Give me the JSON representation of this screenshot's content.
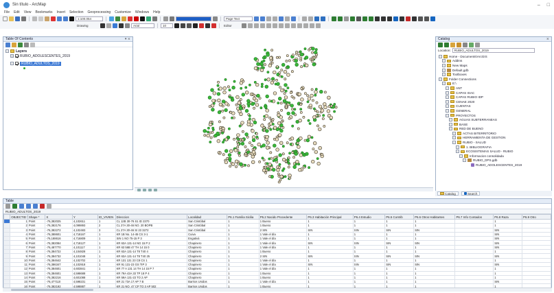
{
  "window": {
    "title": "Sin título - ArcMap",
    "controls": [
      "–",
      "□"
    ]
  },
  "menu": [
    "File",
    "Edit",
    "View",
    "Bookmarks",
    "Insert",
    "Selection",
    "Geoprocessing",
    "Customize",
    "Windows",
    "Help"
  ],
  "toolbar1": {
    "scale": "1:100.054",
    "page_label": "Page Text"
  },
  "toolbar2": {
    "drawing_label": "Drawing",
    "font": "Arial",
    "size": "10",
    "editor_label": "Editor"
  },
  "toc": {
    "title": "Table Of Contents",
    "layers_label": "Layers",
    "items": [
      "RUBIO_ADOLESCENTES_2019",
      "RUBIO_ADULTOS_2019"
    ]
  },
  "catalog": {
    "title": "Catalog",
    "location_label": "Location:",
    "location_value": "RUBIO_ADULTOS_2019",
    "items": [
      {
        "label": "Home - Documents\\ArcGIS",
        "icon": "folder",
        "indent": 0
      },
      {
        "label": "AddIns",
        "icon": "folder",
        "indent": 1
      },
      {
        "label": "New Maps",
        "icon": "folder",
        "indent": 1
      },
      {
        "label": "Default.gdb",
        "icon": "gdb",
        "indent": 1
      },
      {
        "label": "Toolboxes",
        "icon": "folder",
        "indent": 1
      },
      {
        "label": "Folder Connections",
        "icon": "folder",
        "indent": 0
      },
      {
        "label": "E:\\",
        "icon": "folder",
        "indent": 1
      },
      {
        "label": "ANT",
        "icon": "folder",
        "indent": 2
      },
      {
        "label": "CAPAS ISAC",
        "icon": "folder",
        "indent": 2
      },
      {
        "label": "CAPAS RUBIO IDP",
        "icon": "folder",
        "indent": 2
      },
      {
        "label": "CENAE 2020",
        "icon": "folder",
        "indent": 2
      },
      {
        "label": "CUENTAS",
        "icon": "folder",
        "indent": 2
      },
      {
        "label": "GENERAL",
        "icon": "folder",
        "indent": 2
      },
      {
        "label": "PROYECTOS",
        "icon": "folder",
        "indent": 2
      },
      {
        "label": "AGUAS SUBTERRANEAS",
        "icon": "folder",
        "indent": 3
      },
      {
        "label": "BASE",
        "icon": "folder",
        "indent": 3
      },
      {
        "label": "RED DE BUENO",
        "icon": "folder",
        "indent": 3
      },
      {
        "label": "ACTAS BITERRITORIO",
        "icon": "folder",
        "indent": 4
      },
      {
        "label": "HERRAMIENTA DE GESTION",
        "icon": "folder",
        "indent": 4
      },
      {
        "label": "RUBIO - SALUD",
        "icon": "folder",
        "indent": 4
      },
      {
        "label": "1. BIBLIOGRAFIA",
        "icon": "folder",
        "indent": 5
      },
      {
        "label": "ECOSISTEMAS SALUD - RUBIO",
        "icon": "folder",
        "indent": 5
      },
      {
        "label": "Informacion consolidada",
        "icon": "folder",
        "indent": 6
      },
      {
        "label": "RUBIO_DPS.gdb",
        "icon": "gdb",
        "indent": 7
      },
      {
        "label": "RUBIO_ADOLESCENTES_2019",
        "icon": "layer",
        "indent": 8
      }
    ],
    "tabs": [
      "Catalog",
      "Search"
    ]
  },
  "table": {
    "pane_title": "Table",
    "table_title": "RUBIO_ADULTOS_2019",
    "columns": [
      "OBJECTID *",
      "Shape *",
      "X",
      "Y",
      "ID_VIVIEN",
      "Direccion",
      "Localidad",
      "P6.1 Familia Sicilia",
      "P6.2 Nacido Procedente",
      "P6.3 Habitación Principal",
      "P6.4 Estudio",
      "P6.5 Contrib",
      "P6.6 Otros Habitantes",
      "P6.7 Info Contados",
      "P6.8 Raza",
      "P6.9 Otro"
    ],
    "rows": [
      [
        "1",
        "Point",
        "-76,382025",
        "4,102611",
        "1",
        "CL 12B 30-76 S1 ID 2370",
        "San Cristóbal",
        "1",
        "1 Bueno",
        "1",
        "1",
        "1",
        "1",
        "",
        "1",
        ""
      ],
      [
        "2",
        "Point",
        "-76,382176",
        "4,099893",
        "2",
        "CL 27A 30-46 NO. 20 BOPB",
        "San Cristóbal",
        "1",
        "1 Bueno",
        "1",
        "1",
        "1",
        "1",
        "",
        "1",
        ""
      ],
      [
        "3",
        "Point",
        "-76,382272",
        "4,102483",
        "3",
        "CL 27A 30-46 SI 23 3272",
        "San Cristóbal",
        "1",
        "2 SIN",
        "SIN",
        "SIN",
        "SIN",
        "SIN",
        "",
        "SIN",
        ""
      ],
      [
        "4",
        "Point",
        "-76,388601",
        "4,718167",
        "1",
        "KR 1B No. 14-45 CS 3-1",
        "Cuiva",
        "1",
        "1 Vale el día",
        "1",
        "1",
        "1",
        "1",
        "",
        "SIN",
        ""
      ],
      [
        "5",
        "Point",
        "-76,188616",
        "4,716809",
        "1",
        "SIN 1 NO 75-15 P 3",
        "Engativá",
        "1",
        "1 Vale el día",
        "1",
        "1",
        "1",
        "1",
        "",
        "SIN",
        ""
      ],
      [
        "6",
        "Point",
        "-76,382084",
        "4,718127",
        "1",
        "KR 63A 131-14 NG 15 P 2",
        "Chapinero",
        "1",
        "1 Vale el día",
        "SIN",
        "SIN",
        "SIN",
        "SIN",
        "",
        "SIN",
        ""
      ],
      [
        "7",
        "Point",
        "-76,487770",
        "4,101117",
        "1",
        "KR 63 56B 47 TH 14 15 0",
        "Chapinero",
        "1",
        "1 Vale el día",
        "1",
        "1",
        "1",
        "1",
        "",
        "SIN",
        ""
      ],
      [
        "8",
        "Point",
        "-76,384722",
        "4,104828",
        "1",
        "KR 63A 131-14 T8 T40 4",
        "Chapinero",
        "1",
        "1 Bueno",
        "1",
        "1",
        "1",
        "1",
        "",
        "1",
        ""
      ],
      [
        "9",
        "Point",
        "-76,384732",
        "4,101048",
        "1",
        "KR 63A 131-14 T8 T40 25",
        "Chapinero",
        "1",
        "2 SIN",
        "SIN",
        "SIN",
        "SIN",
        "SIN",
        "",
        "SIN",
        ""
      ],
      [
        "10",
        "Point",
        "-76,384642",
        "4,102702",
        "1",
        "KR 131 131 23 C8 CS 1",
        "Chapinero",
        "1",
        "1 Vale el día",
        "1",
        "1",
        "1",
        "1",
        "",
        "1",
        ""
      ],
      [
        "11",
        "Point",
        "-76,386347",
        "4,102918",
        "1",
        "KR 91 131-23 GS TIP 3",
        "Chapinero",
        "1",
        "1 Vale el día",
        "SIN",
        "SIN",
        "SIN",
        "SIN",
        "",
        "SIN",
        ""
      ],
      [
        "12",
        "Point",
        "-76,384601",
        "4,603841",
        "1",
        "KR 77 A 131 14 TH 14 15 P 7",
        "Chapinero",
        "1",
        "1 Vale el día",
        "1",
        "1",
        "1",
        "1",
        "",
        "1",
        ""
      ],
      [
        "13",
        "Point",
        "-76,384601",
        "4,598688",
        "1",
        "KR 79A 43A 33 TP 18 P 4",
        "Chapinero",
        "1",
        "1 Bueno",
        "1",
        "1",
        "1",
        "1",
        "",
        "1",
        ""
      ],
      [
        "14",
        "Point",
        "-76,382216",
        "4,601088",
        "1",
        "KR 59A 131-23 TO 2 AP",
        "Chapinero",
        "1",
        "1 Bueno",
        "1",
        "1",
        "1",
        "1",
        "",
        "1",
        ""
      ],
      [
        "15",
        "Point",
        "-76,477110",
        "4,598231",
        "1",
        "KR 21 73A 17 AP 7 B",
        "Barrios Unidos",
        "1",
        "1 Vale el día",
        "1",
        "1",
        "1",
        "1",
        "",
        "SIN",
        ""
      ],
      [
        "16",
        "Point",
        "-76,382192",
        "4,598887",
        "1",
        "KR 21 NO. 47 CP TO 3 AP 502",
        "Barrios Unidos",
        "1",
        "1 Bueno",
        "1",
        "1",
        "1",
        "1",
        "",
        "1",
        ""
      ]
    ]
  }
}
